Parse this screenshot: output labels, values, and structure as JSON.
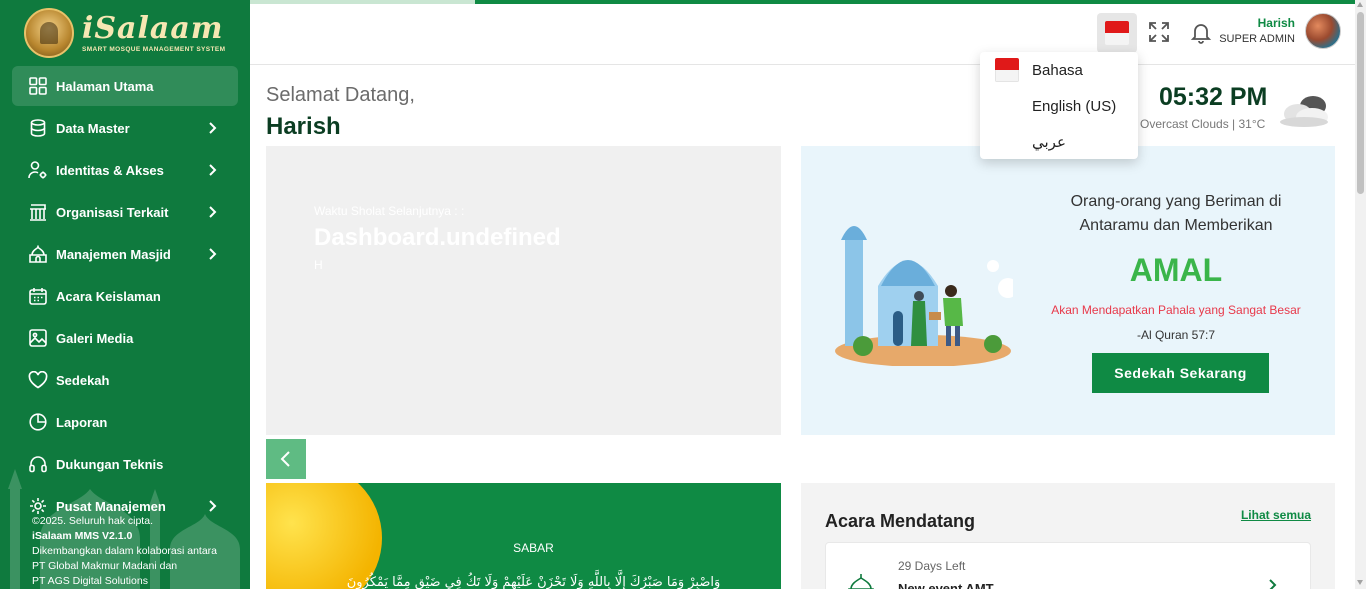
{
  "brand": {
    "title": "iSalaam",
    "subtitle": "SMART MOSQUE MANAGEMENT SYSTEM"
  },
  "sidebar": {
    "items": [
      {
        "label": "Halaman Utama",
        "icon": "dashboard-grid-icon",
        "active": true,
        "has_children": false
      },
      {
        "label": "Data Master",
        "icon": "database-icon",
        "has_children": true
      },
      {
        "label": "Identitas & Akses",
        "icon": "user-gear-icon",
        "has_children": true
      },
      {
        "label": "Organisasi Terkait",
        "icon": "building-icon",
        "has_children": true
      },
      {
        "label": "Manajemen Masjid",
        "icon": "mosque-icon",
        "has_children": true
      },
      {
        "label": "Acara Keislaman",
        "icon": "calendar-icon",
        "has_children": false
      },
      {
        "label": "Galeri Media",
        "icon": "image-icon",
        "has_children": false
      },
      {
        "label": "Sedekah",
        "icon": "heart-icon",
        "has_children": false
      },
      {
        "label": "Laporan",
        "icon": "pie-chart-icon",
        "has_children": false
      },
      {
        "label": "Dukungan Teknis",
        "icon": "headset-icon",
        "has_children": false
      },
      {
        "label": "Pusat Manajemen",
        "icon": "gear-icon",
        "has_children": true
      }
    ],
    "footer": {
      "copyright": "©2025. Seluruh hak cipta.",
      "version": "iSalaam MMS V2.1.0",
      "line1": "Dikembangkan dalam kolaborasi antara",
      "line2": "PT Global Makmur Madani dan",
      "line3": "PT AGS Digital Solutions"
    }
  },
  "header": {
    "user_name": "Harish",
    "user_role": "SUPER ADMIN"
  },
  "language_menu": {
    "items": [
      {
        "label": "Bahasa",
        "flag": "indonesia-flag"
      },
      {
        "label": "English (US)",
        "flag": ""
      },
      {
        "label": "عربي",
        "flag": ""
      }
    ]
  },
  "greeting": {
    "line1": "Selamat Datang,",
    "name": "Harish"
  },
  "clock": {
    "time": "05:32 PM",
    "weather": "Overcast Clouds | 31°C",
    "weather_icon": "cloud-icon"
  },
  "prayer": {
    "label": "Waktu Sholat Selanjutnya : :",
    "value": "Dashboard.undefined",
    "small": "H"
  },
  "amal": {
    "line1": "Orang-orang yang Beriman di",
    "line2": "Antaramu dan Memberikan",
    "title": "AMAL",
    "subtitle": "Akan Mendapatkan Pahala yang Sangat Besar",
    "source": "-Al Quran 57:7",
    "button": "Sedekah Sekarang"
  },
  "quote": {
    "title": "SABAR",
    "arabic": "وَاصْبِرْ وَمَا صَبْرُكَ إِلَّا بِاللَّهِ وَلَا تَحْزَنْ عَلَيْهِمْ وَلَا تَكُ فِي ضَيْقٍ مِمَّا يَمْكُرُونَ"
  },
  "events": {
    "title": "Acara Mendatang",
    "see_all": "Lihat semua",
    "items": [
      {
        "days_left": "29 Days Left",
        "name": "New event AMT"
      }
    ]
  },
  "colors": {
    "primary": "#0f7a3e",
    "accent": "#0f8a44",
    "amal_green": "#3ab54a",
    "alert_red": "#e8394a"
  }
}
